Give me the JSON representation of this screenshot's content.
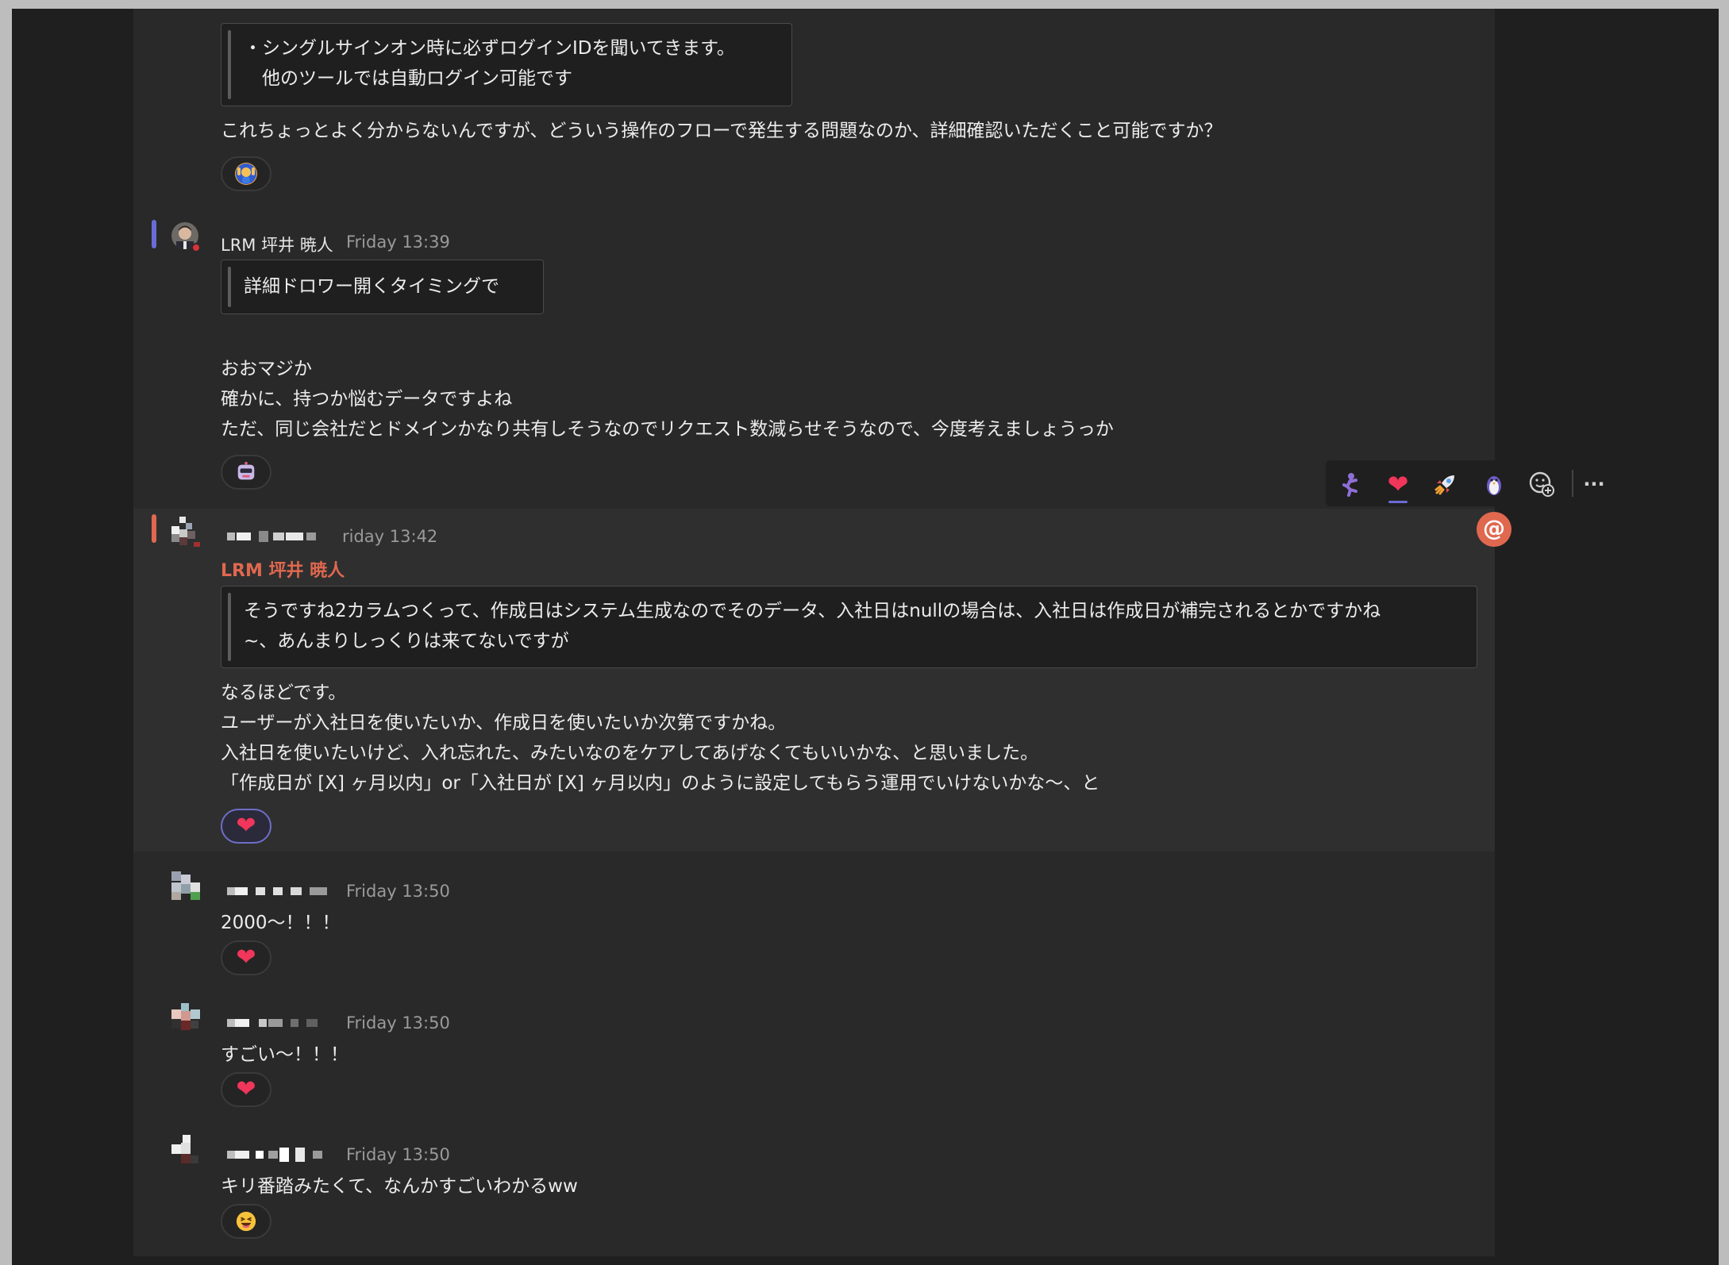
{
  "messages": {
    "m1": {
      "quote": [
        "・シングルサインオン時に必ずログインIDを聞いてきます。",
        "　他のツールでは自動ログイン可能です"
      ],
      "body": [
        "これちょっとよく分からないんですが、どういう操作のフローで発生する問題なのか、詳細確認いただくこと可能ですか？"
      ],
      "reaction": "woman-raising-hands-emoji"
    },
    "m2": {
      "author": "LRM 坪井 暁人",
      "time": "Friday 13:39",
      "quote": [
        "詳細ドロワー開くタイミングで"
      ],
      "body": [
        "おおマジか",
        "確かに、持つか悩むデータですよね",
        "ただ、同じ会社だとドメインかなり共有しそうなのでリクエスト数減らせそうなので、今度考えましょうっか"
      ],
      "reaction": "robot-sunglasses-emoji"
    },
    "m3": {
      "time_fragment": "riday 13:42",
      "mention": "LRM 坪井 暁人",
      "quote": [
        "そうですね2カラムつくって、作成日はシステム生成なのでそのデータ、入社日はnullの場合は、入社日は作成日が補完されるとかですかね",
        "~、あんまりしっくりは来てないですが"
      ],
      "body": [
        "なるほどです。",
        "ユーザーが入社日を使いたいか、作成日を使いたいか次第ですかね。",
        "入社日を使いたいけど、入れ忘れた、みたいなのをケアしてあげなくてもいいかな、と思いました。",
        "「作成日が [X] ヶ月以内」or「入社日が [X] ヶ月以内」のように設定してもらう運用でいけないかな〜、と"
      ],
      "reaction": "heart"
    },
    "m4": {
      "time": "Friday 13:50",
      "body": [
        "2000〜！！！"
      ],
      "reaction": "heart"
    },
    "m5": {
      "time": "Friday 13:50",
      "body": [
        "すごい〜！！！"
      ],
      "reaction": "heart"
    },
    "m6": {
      "time": "Friday 13:50",
      "body": [
        "キリ番踏みたくて、なんかすごいわかるww"
      ],
      "reaction": "grinning-squinting-emoji"
    }
  },
  "toolbar": {
    "items": [
      "dancing-emoji",
      "heart-emoji",
      "rocket-emoji",
      "penguin-emoji",
      "add-reaction-icon",
      "more-options-icon"
    ],
    "more_label": "···"
  },
  "mention_badge": "@",
  "colors": {
    "app_bg": "#1f1f1f",
    "feed_bg": "#292929",
    "highlight_bg": "#2f2f2f",
    "mention_accent": "#e0684f",
    "purple_accent": "#6b6bd6",
    "heart": "#f0365a"
  }
}
